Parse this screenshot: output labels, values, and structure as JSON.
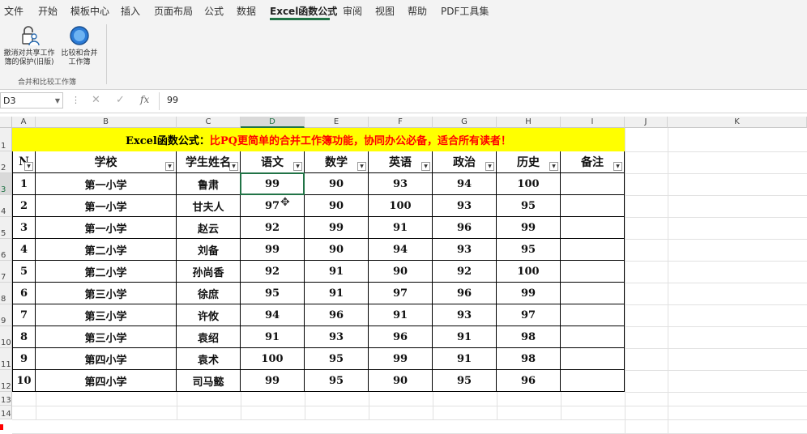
{
  "ribbon_tabs": [
    "文件",
    "开始",
    "模板中心",
    "插入",
    "页面布局",
    "公式",
    "数据",
    "Excel函数公式",
    "审阅",
    "视图",
    "帮助",
    "PDF工具集"
  ],
  "active_tab": "Excel函数公式",
  "ribbon": {
    "btn_unprotect": "撤消对共享工作簿的保护(旧版)",
    "btn_compare": "比较和合并工作簿",
    "group_label": "合并和比较工作簿"
  },
  "formula_bar": {
    "name_box": "D3",
    "formula_value": "99",
    "fx_label": "fx"
  },
  "columns": [
    "A",
    "B",
    "C",
    "D",
    "E",
    "F",
    "G",
    "H",
    "I",
    "J",
    "K"
  ],
  "row_numbers": [
    "1",
    "2",
    "3",
    "4",
    "5",
    "6",
    "7",
    "8",
    "9",
    "10",
    "11",
    "12",
    "13",
    "14"
  ],
  "sheet": {
    "title_black": "Excel函数公式：",
    "title_red": "比PQ更简单的合并工作簿功能，协同办公必备，适合所有读者！",
    "headers": [
      "N",
      "学校",
      "学生姓名",
      "语文",
      "数学",
      "英语",
      "政治",
      "历史",
      "备注"
    ],
    "rows": [
      [
        "1",
        "第一小学",
        "鲁肃",
        "99",
        "90",
        "93",
        "94",
        "100",
        ""
      ],
      [
        "2",
        "第一小学",
        "甘夫人",
        "97",
        "90",
        "100",
        "93",
        "95",
        ""
      ],
      [
        "3",
        "第一小学",
        "赵云",
        "92",
        "99",
        "91",
        "96",
        "99",
        ""
      ],
      [
        "4",
        "第二小学",
        "刘备",
        "99",
        "90",
        "94",
        "93",
        "95",
        ""
      ],
      [
        "5",
        "第二小学",
        "孙尚香",
        "92",
        "91",
        "90",
        "92",
        "100",
        ""
      ],
      [
        "6",
        "第三小学",
        "徐庶",
        "95",
        "91",
        "97",
        "96",
        "99",
        ""
      ],
      [
        "7",
        "第三小学",
        "许攸",
        "94",
        "96",
        "91",
        "93",
        "97",
        ""
      ],
      [
        "8",
        "第三小学",
        "袁绍",
        "91",
        "93",
        "96",
        "91",
        "98",
        ""
      ],
      [
        "9",
        "第四小学",
        "袁术",
        "100",
        "95",
        "99",
        "91",
        "98",
        ""
      ],
      [
        "10",
        "第四小学",
        "司马懿",
        "99",
        "95",
        "90",
        "95",
        "96",
        ""
      ]
    ]
  },
  "colors": {
    "accent": "#217346",
    "title_fill": "#ffff00",
    "title_red": "#ff0000"
  }
}
